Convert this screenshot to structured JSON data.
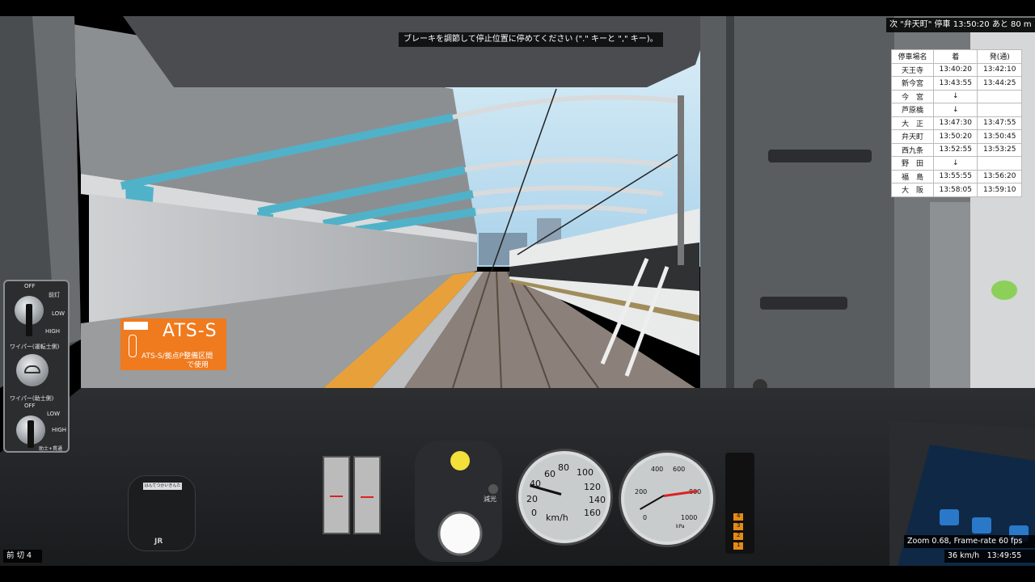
{
  "hint": "ブレーキを調節して停止位置に停めてください (\".\" キーと \",\" キー)。",
  "next_stop": "次 \"弁天町\" 停車 13:50:20 あと 80 m",
  "timetable": {
    "headers": [
      "停車場名",
      "着",
      "発(通)"
    ],
    "rows": [
      [
        "天王寺",
        "13:40:20",
        "13:42:10"
      ],
      [
        "新今宮",
        "13:43:55",
        "13:44:25"
      ],
      [
        "今　宮",
        "↓",
        ""
      ],
      [
        "芦原橋",
        "↓",
        ""
      ],
      [
        "大　正",
        "13:47:30",
        "13:47:55"
      ],
      [
        "弁天町",
        "13:50:20",
        "13:50:45"
      ],
      [
        "西九条",
        "13:52:55",
        "13:53:25"
      ],
      [
        "野　田",
        "↓",
        ""
      ],
      [
        "福　島",
        "13:55:55",
        "13:56:20"
      ],
      [
        "大　阪",
        "13:58:05",
        "13:59:10"
      ]
    ]
  },
  "frame_info": "Zoom 0.68, Frame-rate 60 fps",
  "speed_time": "36 km/h　13:49:55",
  "notch": "前 切 4",
  "ats": {
    "title": "ATS-S",
    "desc_line1": "ATS-S/拠点P整備区間",
    "desc_line2": "で使用"
  },
  "left_panel": {
    "off1": "OFF",
    "front": "前灯",
    "low1": "LOW",
    "high1": "HIGH",
    "wiper_driver": "ワイパー(運転士側)",
    "wiper_assist": "ワイパー(助士側)",
    "off2": "OFF",
    "low2": "LOW",
    "high2": "HIGH",
    "assist_footer": "助士+貫通"
  },
  "mic": {
    "label": "はんてつかいきんたりしゃ2 2 5",
    "brand": "JR"
  },
  "dim_label": "減光",
  "speedometer": {
    "unit": "km/h",
    "ticks": [
      "0",
      "20",
      "40",
      "60",
      "80",
      "100",
      "120",
      "140",
      "160"
    ],
    "speed_kmh": 36
  },
  "pressure_gauge": {
    "ticks": [
      "0",
      "200",
      "400",
      "600",
      "800",
      "1000"
    ],
    "unit": "kPa"
  },
  "notch_lamps": [
    "4",
    "3",
    "2",
    "1"
  ],
  "colors": {
    "ats_orange": "#f07a1e",
    "sky": "#bfe0f2",
    "platform_yellow": "#e8a13a",
    "lamp_yellow": "#f3e03a"
  }
}
